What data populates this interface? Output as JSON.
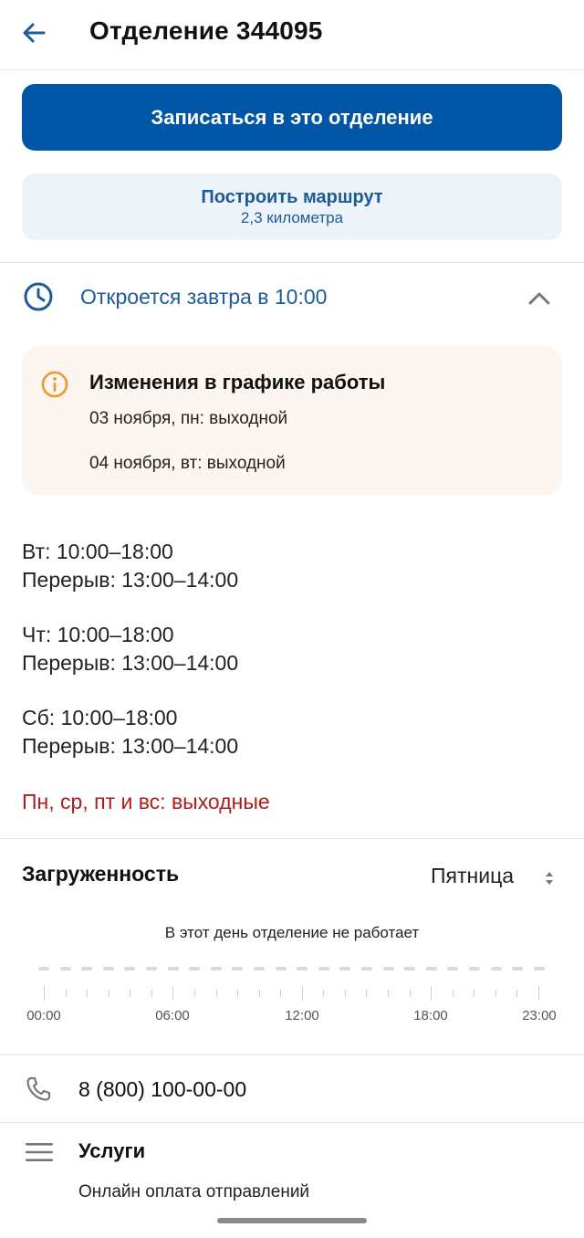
{
  "header": {
    "title": "Отделение 344095",
    "back_icon": "arrow-left-icon"
  },
  "actions": {
    "book_label": "Записаться в это отделение",
    "route_label": "Построить маршрут",
    "route_distance": "2,3 километра"
  },
  "hours": {
    "status": "Откроется завтра в 10:00",
    "expanded": true
  },
  "notice": {
    "title": "Изменения в графике работы",
    "lines": [
      "03 ноября, пн: выходной",
      "04 ноября, вт: выходной"
    ]
  },
  "schedule": [
    {
      "day": "Вт: 10:00–18:00",
      "break": "Перерыв: 13:00–14:00"
    },
    {
      "day": "Чт: 10:00–18:00",
      "break": "Перерыв: 13:00–14:00"
    },
    {
      "day": "Сб: 10:00–18:00",
      "break": "Перерыв: 13:00–14:00"
    }
  ],
  "weekend_text": "Пн, ср, пт и вс: выходные",
  "load": {
    "title": "Загруженность",
    "selected_day": "Пятница",
    "closed_message": "В этот день отделение не работает",
    "time_labels": [
      "00:00",
      "06:00",
      "12:00",
      "18:00",
      "23:00"
    ]
  },
  "phone": {
    "number": "8 (800) 100-00-00"
  },
  "services": {
    "title": "Услуги",
    "items": [
      "Онлайн оплата отправлений"
    ]
  },
  "colors": {
    "primary": "#0055a6",
    "link": "#1c5a98",
    "notice_bg": "#fdf5ef",
    "warning_icon": "#f0972d",
    "weekend_red": "#b01c1c"
  }
}
